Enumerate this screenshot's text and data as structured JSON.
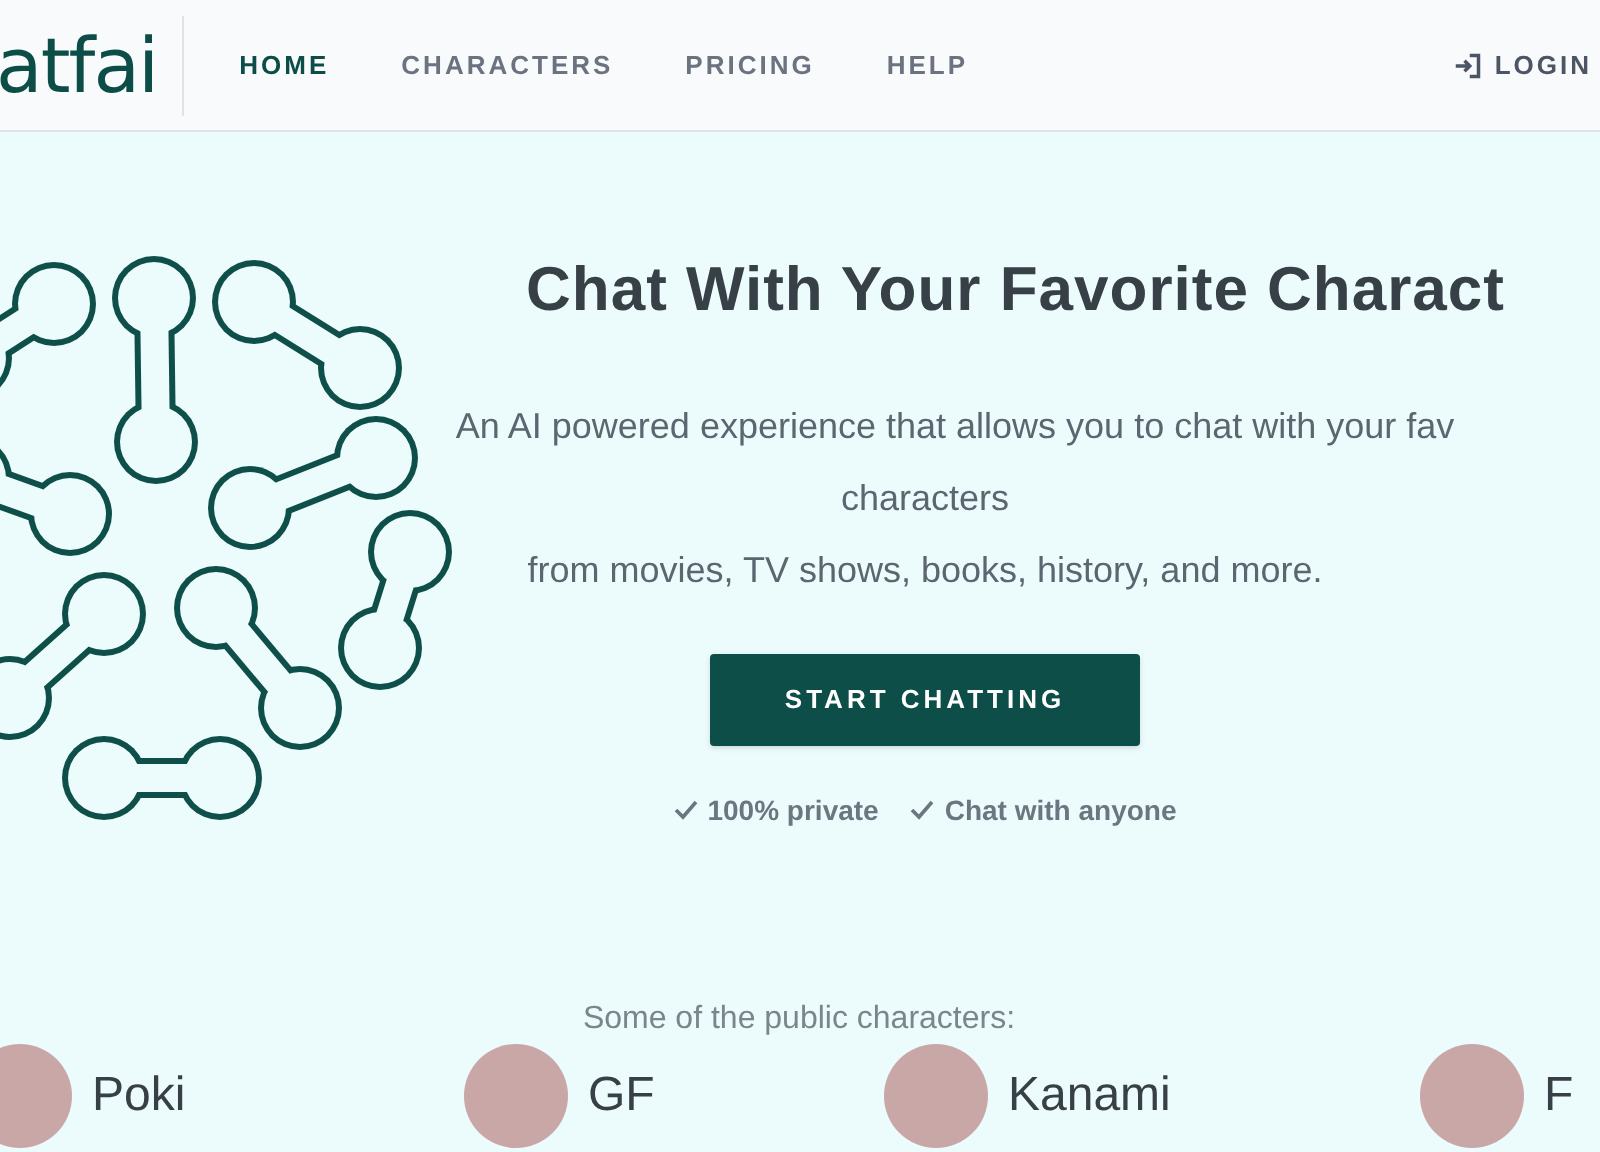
{
  "logo": "atfai",
  "nav": [
    {
      "label": "HOME",
      "selected": true
    },
    {
      "label": "CHARACTERS",
      "selected": false
    },
    {
      "label": "PRICING",
      "selected": false
    },
    {
      "label": "HELP",
      "selected": false
    }
  ],
  "login": "LOGIN",
  "hero": {
    "title": "Chat With Your Favorite Charact",
    "lines": [
      "An AI powered experience that allows you to chat with your fav",
      "characters",
      "from movies, TV shows, books, history, and more."
    ],
    "button": "START CHATTING",
    "features": [
      "100% private",
      "Chat with anyone"
    ]
  },
  "public_heading": "Some of the public characters:",
  "characters": [
    "Poki",
    "GF",
    "Kanami",
    "F"
  ]
}
